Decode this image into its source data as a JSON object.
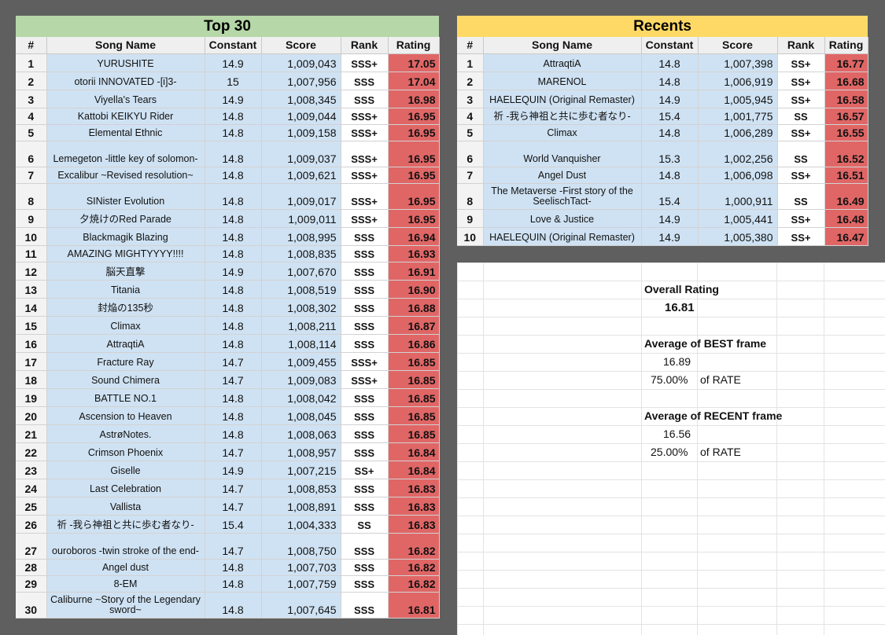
{
  "top30": {
    "title": "Top 30",
    "title_color": "#b6d7a8",
    "headers": [
      "#",
      "Song Name",
      "Constant",
      "Score",
      "Rank",
      "Rating"
    ],
    "rows": [
      [
        "1",
        "YURUSHITE",
        "14.9",
        "1,009,043",
        "SSS+",
        "17.05"
      ],
      [
        "2",
        "otorii INNOVATED -[i]3-",
        "15",
        "1,007,956",
        "SSS",
        "17.04"
      ],
      [
        "3",
        "Viyella's Tears",
        "14.9",
        "1,008,345",
        "SSS",
        "16.98"
      ],
      [
        "4",
        "Kattobi KEIKYU Rider",
        "14.8",
        "1,009,044",
        "SSS+",
        "16.95"
      ],
      [
        "5",
        "Elemental Ethnic",
        "14.8",
        "1,009,158",
        "SSS+",
        "16.95"
      ],
      [
        "6",
        "Lemegeton -little key of solomon-",
        "14.8",
        "1,009,037",
        "SSS+",
        "16.95"
      ],
      [
        "7",
        "Excalibur ~Revised resolution~",
        "14.8",
        "1,009,621",
        "SSS+",
        "16.95"
      ],
      [
        "8",
        "SINister Evolution",
        "14.8",
        "1,009,017",
        "SSS+",
        "16.95"
      ],
      [
        "9",
        "夕焼けのRed Parade",
        "14.8",
        "1,009,011",
        "SSS+",
        "16.95"
      ],
      [
        "10",
        "Blackmagik Blazing",
        "14.8",
        "1,008,995",
        "SSS",
        "16.94"
      ],
      [
        "11",
        "AMAZING MIGHTYYYY!!!!",
        "14.8",
        "1,008,835",
        "SSS",
        "16.93"
      ],
      [
        "12",
        "脳天直撃",
        "14.9",
        "1,007,670",
        "SSS",
        "16.91"
      ],
      [
        "13",
        "Titania",
        "14.8",
        "1,008,519",
        "SSS",
        "16.90"
      ],
      [
        "14",
        "封焔の135秒",
        "14.8",
        "1,008,302",
        "SSS",
        "16.88"
      ],
      [
        "15",
        "Climax",
        "14.8",
        "1,008,211",
        "SSS",
        "16.87"
      ],
      [
        "16",
        "AttraqtiA",
        "14.8",
        "1,008,114",
        "SSS",
        "16.86"
      ],
      [
        "17",
        "Fracture Ray",
        "14.7",
        "1,009,455",
        "SSS+",
        "16.85"
      ],
      [
        "18",
        "Sound Chimera",
        "14.7",
        "1,009,083",
        "SSS+",
        "16.85"
      ],
      [
        "19",
        "BATTLE NO.1",
        "14.8",
        "1,008,042",
        "SSS",
        "16.85"
      ],
      [
        "20",
        "Ascension to Heaven",
        "14.8",
        "1,008,045",
        "SSS",
        "16.85"
      ],
      [
        "21",
        "AstrøNotes.",
        "14.8",
        "1,008,063",
        "SSS",
        "16.85"
      ],
      [
        "22",
        "Crimson Phoenix",
        "14.7",
        "1,008,957",
        "SSS",
        "16.84"
      ],
      [
        "23",
        "Giselle",
        "14.9",
        "1,007,215",
        "SS+",
        "16.84"
      ],
      [
        "24",
        "Last Celebration",
        "14.7",
        "1,008,853",
        "SSS",
        "16.83"
      ],
      [
        "25",
        "Vallista",
        "14.7",
        "1,008,891",
        "SSS",
        "16.83"
      ],
      [
        "26",
        "祈 -我ら神祖と共に歩む者なり-",
        "15.4",
        "1,004,333",
        "SS",
        "16.83"
      ],
      [
        "27",
        "ouroboros -twin stroke of the end-",
        "14.7",
        "1,008,750",
        "SSS",
        "16.82"
      ],
      [
        "28",
        "Angel dust",
        "14.8",
        "1,007,703",
        "SSS",
        "16.82"
      ],
      [
        "29",
        "8-EM",
        "14.8",
        "1,007,759",
        "SSS",
        "16.82"
      ],
      [
        "30",
        "Caliburne ~Story of the Legendary sword~",
        "14.8",
        "1,007,645",
        "SSS",
        "16.81"
      ]
    ]
  },
  "recents": {
    "title": "Recents",
    "title_color": "#ffd966",
    "headers": [
      "#",
      "Song Name",
      "Constant",
      "Score",
      "Rank",
      "Rating"
    ],
    "rows": [
      [
        "1",
        "AttraqtiA",
        "14.8",
        "1,007,398",
        "SS+",
        "16.77"
      ],
      [
        "2",
        "MARENOL",
        "14.8",
        "1,006,919",
        "SS+",
        "16.68"
      ],
      [
        "3",
        "HAELEQUIN (Original Remaster)",
        "14.9",
        "1,005,945",
        "SS+",
        "16.58"
      ],
      [
        "4",
        "祈 -我ら神祖と共に歩む者なり-",
        "15.4",
        "1,001,775",
        "SS",
        "16.57"
      ],
      [
        "5",
        "Climax",
        "14.8",
        "1,006,289",
        "SS+",
        "16.55"
      ],
      [
        "6",
        "World Vanquisher",
        "15.3",
        "1,002,256",
        "SS",
        "16.52"
      ],
      [
        "7",
        "Angel Dust",
        "14.8",
        "1,006,098",
        "SS+",
        "16.51"
      ],
      [
        "8",
        "The Metaverse -First story of the SeelischTact-",
        "15.4",
        "1,000,911",
        "SS",
        "16.49"
      ],
      [
        "9",
        "Love & Justice",
        "14.9",
        "1,005,441",
        "SS+",
        "16.48"
      ],
      [
        "10",
        "HAELEQUIN (Original Remaster)",
        "14.9",
        "1,005,380",
        "SS+",
        "16.47"
      ]
    ]
  },
  "summary": {
    "overall_label": "Overall Rating",
    "overall_value": "16.81",
    "best_label": "Average of BEST frame",
    "best_value": "16.89",
    "best_pct": "75.00%",
    "best_of": "of RATE",
    "recent_label": "Average of RECENT frame",
    "recent_value": "16.56",
    "recent_pct": "25.00%",
    "recent_of": "of RATE"
  }
}
